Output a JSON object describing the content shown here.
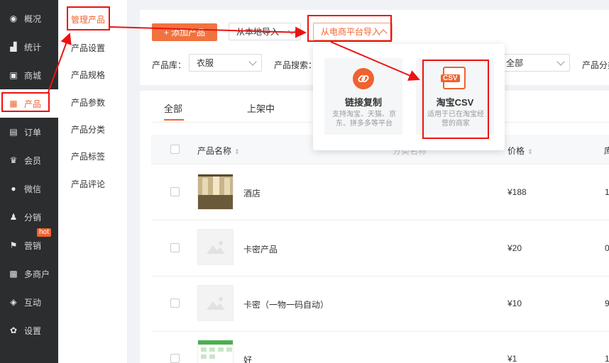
{
  "nav": {
    "items": [
      {
        "label": "概况",
        "icon": "eye-icon"
      },
      {
        "label": "统计",
        "icon": "chart-icon"
      },
      {
        "label": "商城",
        "icon": "shop-icon"
      },
      {
        "label": "产品",
        "icon": "product-icon"
      },
      {
        "label": "订单",
        "icon": "order-icon"
      },
      {
        "label": "会员",
        "icon": "crown-icon"
      },
      {
        "label": "微信",
        "icon": "wechat-icon"
      },
      {
        "label": "分销",
        "icon": "distribution-icon"
      },
      {
        "label": "营销",
        "icon": "flag-icon"
      },
      {
        "label": "多商户",
        "icon": "merchant-icon"
      },
      {
        "label": "互动",
        "icon": "interact-icon"
      },
      {
        "label": "设置",
        "icon": "gear-icon"
      }
    ],
    "hot_badge": "hot"
  },
  "submenu": {
    "items": [
      "管理产品",
      "产品设置",
      "产品规格",
      "产品参数",
      "产品分类",
      "产品标签",
      "产品评论"
    ]
  },
  "toolbar": {
    "add_label": "+ 添加产品",
    "local_import": "从本地导入",
    "platform_import": "从电商平台导入"
  },
  "filters": {
    "library_label": "产品库：",
    "library_value": "衣服",
    "search_label": "产品搜索：",
    "status_value": "全部",
    "category_label": "产品分类"
  },
  "tabs": [
    "全部",
    "上架中"
  ],
  "table": {
    "headers": {
      "name": "产品名称",
      "category": "分类名称",
      "price": "价格",
      "stock": "库"
    },
    "rows": [
      {
        "name": "酒店",
        "price": "¥188",
        "stock": "1"
      },
      {
        "name": "卡密产品",
        "price": "¥20",
        "stock": "0"
      },
      {
        "name": "卡密（一物一码自动）",
        "price": "¥10",
        "stock": "9"
      },
      {
        "name": "好",
        "price": "¥1",
        "stock": "1"
      }
    ]
  },
  "popup": {
    "option1_title": "链接复制",
    "option1_desc": "支持淘宝、天猫、京东、拼多多等平台",
    "option2_title": "淘宝CSV",
    "option2_desc": "适用于已在淘宝经营的商家",
    "csv_badge": "CSV"
  },
  "colors": {
    "accent": "#f0622f",
    "nav_bg": "#2b2d2f",
    "annotation": "#e11111"
  }
}
